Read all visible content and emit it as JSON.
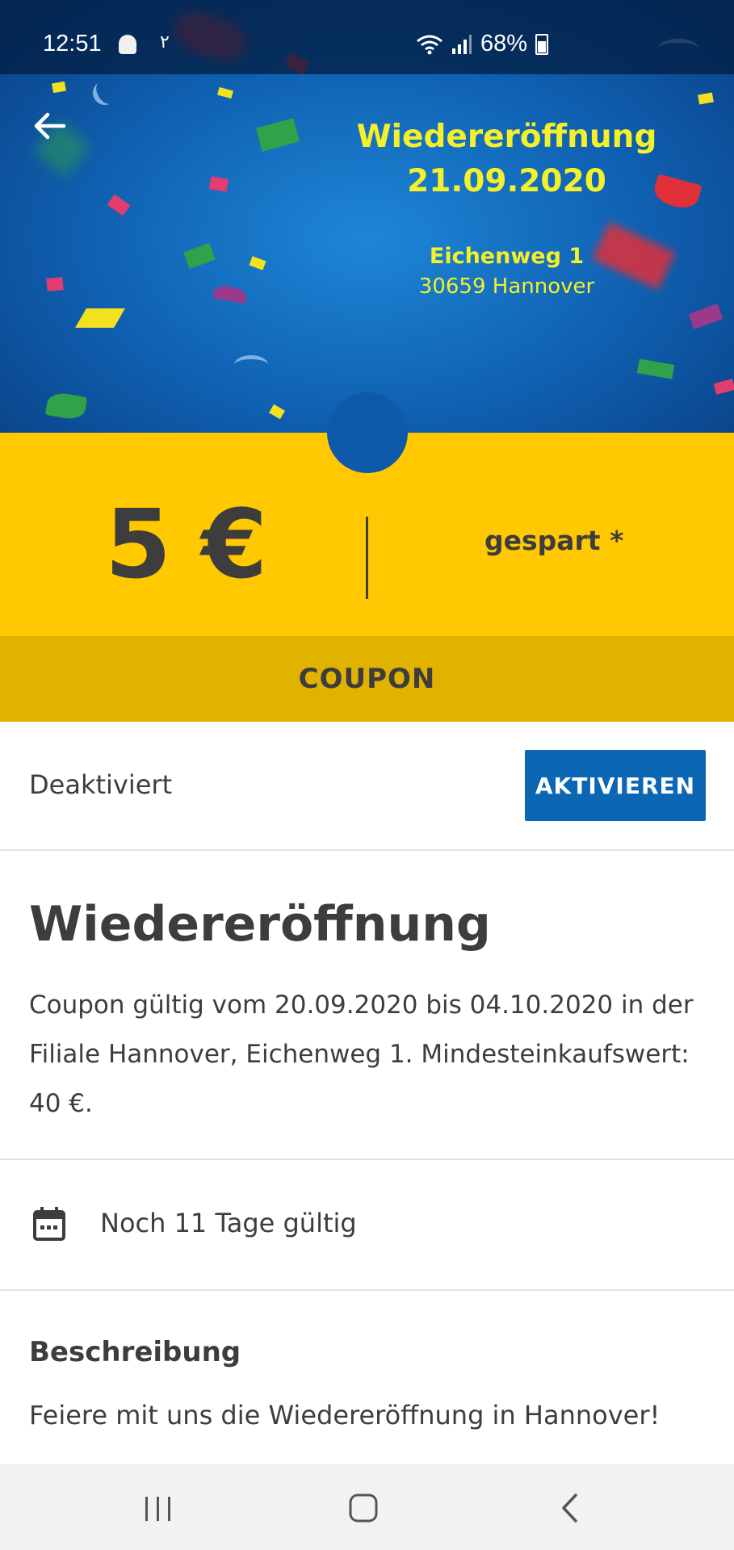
{
  "status_bar": {
    "time": "12:51",
    "extra_glyph": "٢",
    "battery": "68%",
    "icons": [
      "ghost-icon",
      "wifi-icon",
      "signal-icon",
      "battery-icon"
    ]
  },
  "hero": {
    "title_line1": "Wiedereröffnung",
    "title_line2": "21.09.2020",
    "address_line1": "Eichenweg 1",
    "address_line2": "30659 Hannover"
  },
  "coupon": {
    "amount": "5 €",
    "saved_label": "gespart *",
    "band_label": "COUPON"
  },
  "activation": {
    "status": "Deaktiviert",
    "button_label": "AKTIVIEREN"
  },
  "details": {
    "title": "Wiedereröffnung",
    "description": "Coupon gültig vom 20.09.2020 bis 04.10.2020 in der Filiale Hannover, Eichenweg 1. Mindesteinkaufswert: 40 €.",
    "validity_prefix": "Noch ",
    "validity_days": "11",
    "validity_suffix": " Tage gültig"
  },
  "description_section": {
    "heading": "Beschreibung",
    "text": "Feiere mit uns die Wiedereröffnung in Hannover!"
  },
  "colors": {
    "brand_blue": "#0b66b3",
    "coupon_yellow": "#ffc800",
    "coupon_band": "#e1b300",
    "hero_text": "#f4f12a"
  }
}
